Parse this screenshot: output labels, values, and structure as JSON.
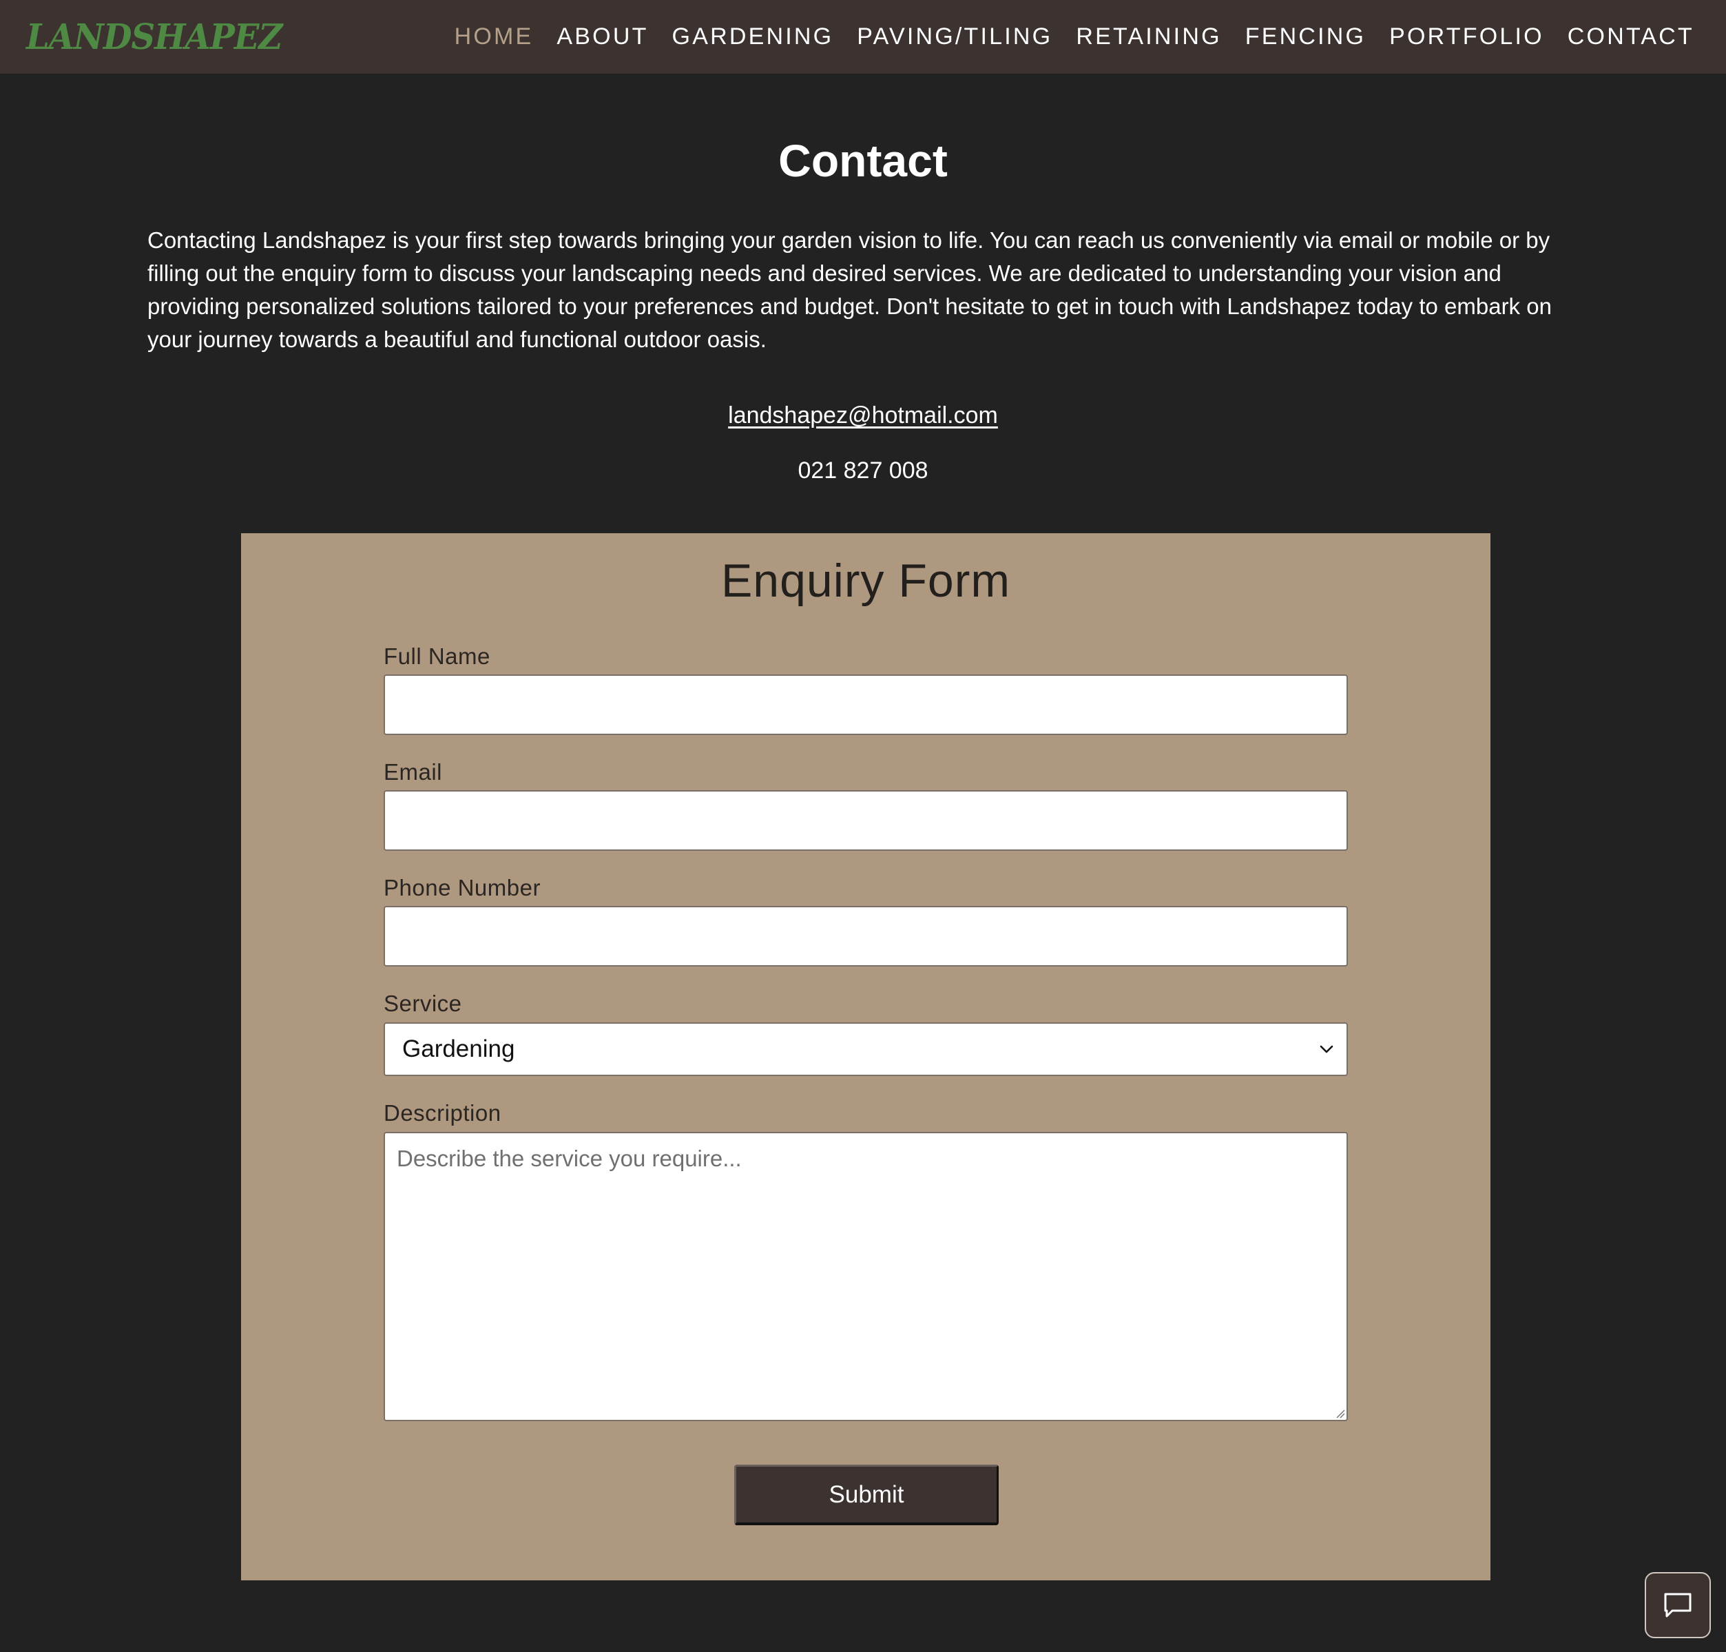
{
  "brand": {
    "logo_text": "LANDSHAPEZ",
    "logo_color": "#4e8a43"
  },
  "nav": {
    "items": [
      {
        "label": "HOME",
        "active": true
      },
      {
        "label": "ABOUT",
        "active": false
      },
      {
        "label": "GARDENING",
        "active": false
      },
      {
        "label": "PAVING/TILING",
        "active": false
      },
      {
        "label": "RETAINING",
        "active": false
      },
      {
        "label": "FENCING",
        "active": false
      },
      {
        "label": "PORTFOLIO",
        "active": false
      },
      {
        "label": "CONTACT",
        "active": false
      }
    ],
    "active_color": "#b5a18a"
  },
  "page": {
    "title": "Contact",
    "intro": "Contacting Landshapez is your first step towards bringing your garden vision to life. You can reach us conveniently via email or mobile or by filling out the enquiry form to discuss your landscaping needs and desired services. We are dedicated to understanding your vision and providing personalized solutions tailored to your preferences and budget. Don't hesitate to get in touch with Landshapez today to embark on your journey towards a beautiful and functional outdoor oasis.",
    "email": "landshapez@hotmail.com",
    "phone": "021 827 008"
  },
  "form": {
    "title": "Enquiry Form",
    "full_name": {
      "label": "Full Name",
      "value": ""
    },
    "email": {
      "label": "Email",
      "value": ""
    },
    "phone": {
      "label": "Phone Number",
      "value": ""
    },
    "service": {
      "label": "Service",
      "selected": "Gardening"
    },
    "description": {
      "label": "Description",
      "value": "",
      "placeholder": "Describe the service you require..."
    },
    "submit_label": "Submit",
    "panel_color": "#ae9880"
  },
  "chat_widget": {
    "icon": "chat-bubble-icon"
  },
  "colors": {
    "background": "#222222",
    "navbar": "#3c3330",
    "button": "#3c3330"
  }
}
